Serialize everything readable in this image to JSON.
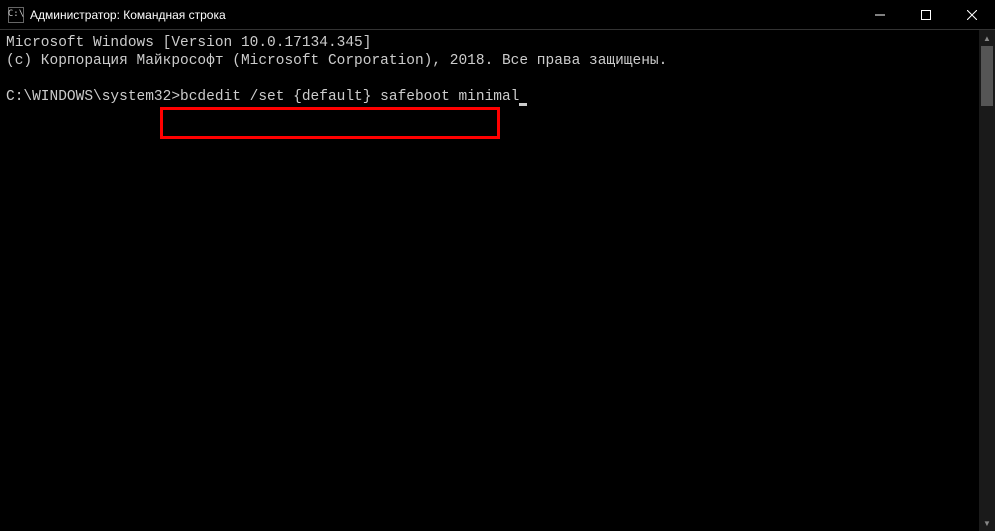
{
  "window": {
    "title": "Администратор: Командная строка"
  },
  "terminal": {
    "line1": "Microsoft Windows [Version 10.0.17134.345]",
    "line2": "(c) Корпорация Майкрософт (Microsoft Corporation), 2018. Все права защищены.",
    "prompt": "C:\\WINDOWS\\system32>",
    "command": "bcdedit /set {default} safeboot minimal"
  },
  "icons": {
    "cmd_label": "C:\\"
  }
}
